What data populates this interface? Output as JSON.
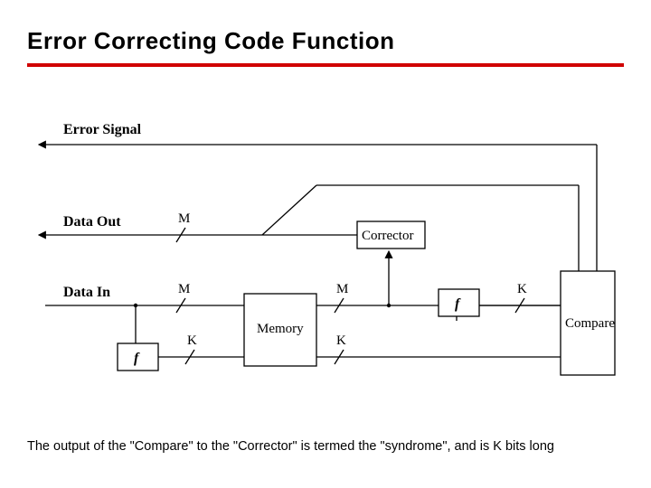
{
  "title": "Error Correcting Code Function",
  "labels": {
    "error_signal": "Error Signal",
    "data_out": "Data Out",
    "data_in": "Data In"
  },
  "blocks": {
    "corrector": "Corrector",
    "memory": "Memory",
    "compare": "Compare",
    "f1": "f",
    "f2": "f"
  },
  "signals": {
    "m1": "M",
    "m2": "M",
    "m3": "M",
    "k1": "K",
    "k2": "K",
    "k3": "K"
  },
  "caption": "The output of the \"Compare\" to the \"Corrector\" is termed the \"syndrome\", and is K bits long"
}
